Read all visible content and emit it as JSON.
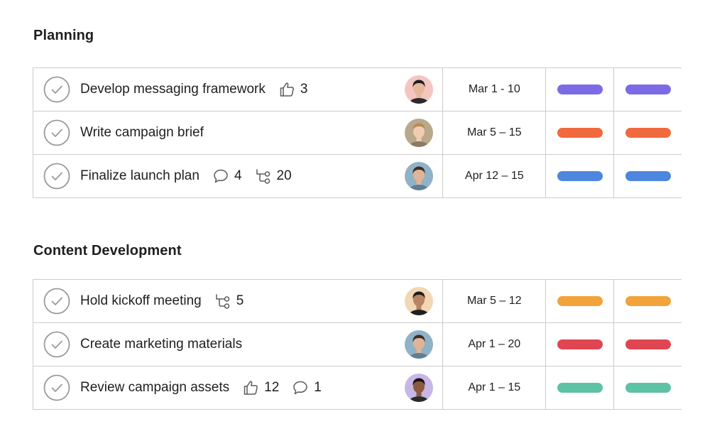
{
  "sections": [
    {
      "title": "Planning",
      "tasks": [
        {
          "name": "Develop messaging framework",
          "likes": "3",
          "dates": "Mar 1 - 10",
          "color": "#7b6be6",
          "avatar_bg": "#f4c6c2",
          "avatar_skin": "#e7b79a",
          "avatar_hair": "#1d1d1f",
          "avatar_shirt": "#2b2b2b"
        },
        {
          "name": "Write campaign brief",
          "dates": "Mar 5 – 15",
          "color": "#f06a3e",
          "avatar_bg": "#b9a98c",
          "avatar_skin": "#f0cdb1",
          "avatar_hair": "#b98a5a",
          "avatar_shirt": "#8a7b64"
        },
        {
          "name": "Finalize launch plan",
          "comments": "4",
          "subtasks": "20",
          "dates": "Apr 12 – 15",
          "color": "#4d86df",
          "avatar_bg": "#8fb2c6",
          "avatar_skin": "#e0b496",
          "avatar_hair": "#3a2e27",
          "avatar_shirt": "#5f7f94"
        }
      ]
    },
    {
      "title": "Content Development",
      "tasks": [
        {
          "name": "Hold kickoff meeting",
          "subtasks": "5",
          "dates": "Mar 5 – 12",
          "color": "#f2a33a",
          "avatar_bg": "#f2d7b5",
          "avatar_skin": "#b98462",
          "avatar_hair": "#1f1a18",
          "avatar_shirt": "#1f1f1f"
        },
        {
          "name": "Create marketing materials",
          "dates": "Apr 1 – 20",
          "color": "#df4652",
          "avatar_bg": "#8fb2c6",
          "avatar_skin": "#e0b496",
          "avatar_hair": "#3a2e27",
          "avatar_shirt": "#5f7f94"
        },
        {
          "name": "Review campaign assets",
          "likes": "12",
          "comments": "1",
          "dates": "Apr 1 – 15",
          "color": "#5ec2a5",
          "avatar_bg": "#c8b6e6",
          "avatar_skin": "#8a5a3e",
          "avatar_hair": "#1a1412",
          "avatar_shirt": "#2a2a2a"
        }
      ]
    }
  ],
  "icons": {
    "check": "check-circle-icon",
    "like": "thumbs-up-icon",
    "comment": "comment-icon",
    "subtask": "subtask-icon"
  }
}
